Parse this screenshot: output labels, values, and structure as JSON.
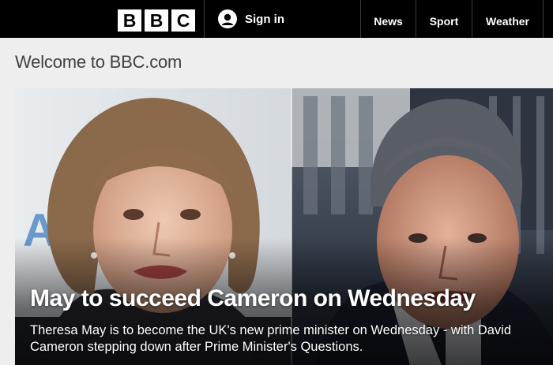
{
  "header": {
    "logo_letters": [
      "B",
      "B",
      "C"
    ],
    "signin_label": "Sign in",
    "nav": [
      {
        "label": "News"
      },
      {
        "label": "Sport"
      },
      {
        "label": "Weather"
      }
    ],
    "colors": {
      "bar": "#000000",
      "text": "#ffffff"
    }
  },
  "welcome": {
    "title": "Welcome to BBC.com"
  },
  "hero": {
    "headline": "May to succeed Cameron on Wednesday",
    "summary": "Theresa May is to become the UK's new prime minister on Wednesday - with David Cameron stepping down after Prime Minister's Questions.",
    "images": [
      "theresa-may-photo",
      "david-cameron-photo"
    ]
  }
}
